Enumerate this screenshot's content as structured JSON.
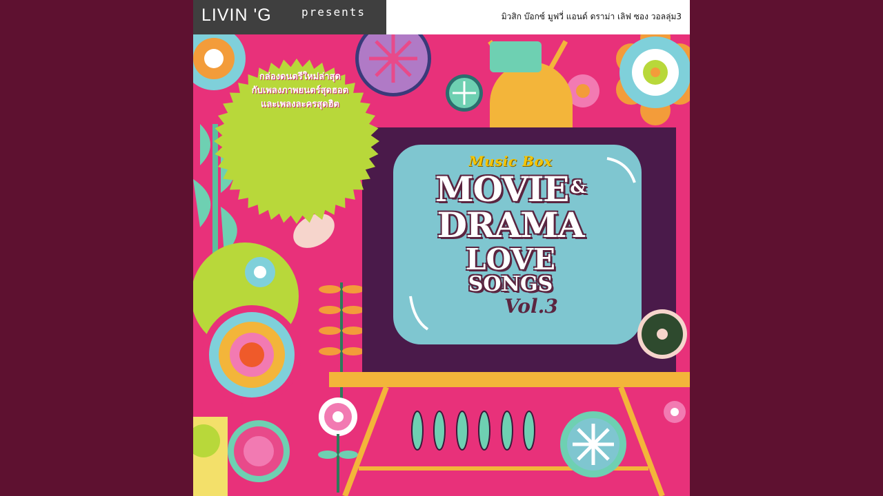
{
  "header": {
    "brand_logo": "LIVIN 'G",
    "brand_presents": "presents",
    "thai_title": "มิวสิก บ๊อกซ์ มูฟวี่ แอนด์ ดราม่า เลิฟ ซอง วอลลุ่ม3"
  },
  "badge": {
    "lines": [
      "กล่องดนตรีใหม่ล่าสุด",
      "กับเพลงภาพยนตร์สุดฮอต",
      "และเพลงละครสุดฮิต"
    ]
  },
  "tv": {
    "eyebrow": "Music Box",
    "line1": "MOVIE",
    "amp": "&",
    "line2": "DRAMA",
    "line3": "LOVE",
    "line4": "SONGS",
    "vol": "Vol.3"
  },
  "colors": {
    "background": "#5e1130",
    "cover_pink": "#e8317a",
    "tv_screen": "#7fc6d0",
    "tv_frame": "#4a1a4a",
    "badge_green": "#b8d83a",
    "tv_stand_yellow": "#f3b53a"
  }
}
